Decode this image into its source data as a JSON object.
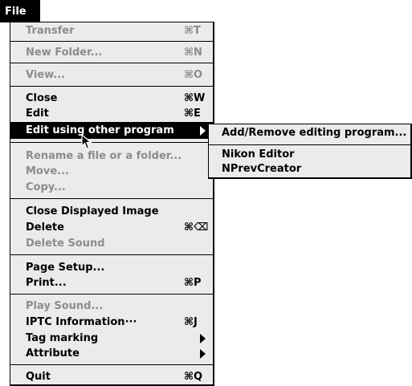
{
  "menubar": {
    "title": "File"
  },
  "menu": {
    "items": [
      {
        "label": "Transfer",
        "shortcut": "⌘T"
      },
      {
        "label": "New Folder...",
        "shortcut": "⌘N"
      },
      {
        "label": "View...",
        "shortcut": "⌘O"
      },
      {
        "label": "Close",
        "shortcut": "⌘W"
      },
      {
        "label": "Edit",
        "shortcut": "⌘E"
      },
      {
        "label": "Edit using other program",
        "shortcut": ""
      },
      {
        "label": "Rename a file or a folder...",
        "shortcut": ""
      },
      {
        "label": "Move...",
        "shortcut": ""
      },
      {
        "label": "Copy...",
        "shortcut": ""
      },
      {
        "label": "Close Displayed Image",
        "shortcut": ""
      },
      {
        "label": "Delete",
        "shortcut": "⌘⌫"
      },
      {
        "label": "Delete Sound",
        "shortcut": ""
      },
      {
        "label": "Page Setup...",
        "shortcut": ""
      },
      {
        "label": "Print...",
        "shortcut": "⌘P"
      },
      {
        "label": "Play Sound...",
        "shortcut": ""
      },
      {
        "label": "IPTC Information···",
        "shortcut": "⌘J"
      },
      {
        "label": "Tag marking",
        "shortcut": ""
      },
      {
        "label": "Attribute",
        "shortcut": ""
      },
      {
        "label": "Quit",
        "shortcut": "⌘Q"
      }
    ]
  },
  "submenu": {
    "items": [
      {
        "label": "Add/Remove editing program..."
      },
      {
        "label": "Nikon Editor"
      },
      {
        "label": "NPrevCreator"
      }
    ]
  }
}
